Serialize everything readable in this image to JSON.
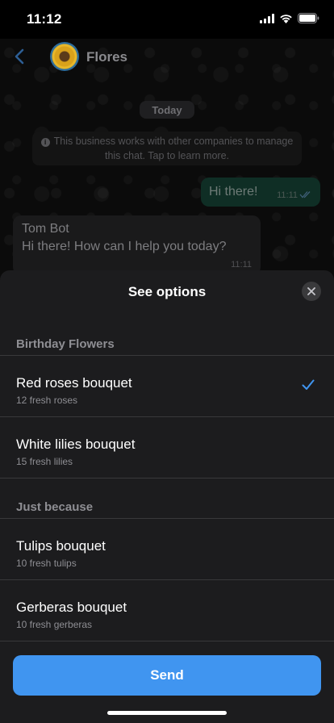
{
  "status_bar": {
    "time": "11:12"
  },
  "chat": {
    "title": "Flores",
    "date_label": "Today",
    "business_notice": "This business works with other companies to manage this chat. Tap to learn more.",
    "outgoing_message": {
      "text": "Hi there!",
      "time": "11:11"
    },
    "incoming_message": {
      "sender": "Tom Bot",
      "text": "Hi there! How can I help you today?",
      "time": "11:11"
    }
  },
  "sheet": {
    "title": "See options",
    "sections": [
      {
        "header": "Birthday Flowers",
        "options": [
          {
            "title": "Red roses bouquet",
            "subtitle": "12 fresh roses",
            "selected": true
          },
          {
            "title": "White lilies bouquet",
            "subtitle": "15 fresh lilies",
            "selected": false
          }
        ]
      },
      {
        "header": "Just because",
        "options": [
          {
            "title": "Tulips bouquet",
            "subtitle": "10 fresh tulips",
            "selected": false
          },
          {
            "title": "Gerberas bouquet",
            "subtitle": "10 fresh gerberas",
            "selected": false
          }
        ]
      }
    ],
    "send_label": "Send"
  },
  "colors": {
    "accent": "#4095f0",
    "sheet_background": "#1c1c1e",
    "outgoing_bubble": "#0f2e25"
  },
  "icons": [
    "signal-icon",
    "wifi-icon",
    "battery-icon",
    "back-chevron-icon",
    "info-icon",
    "double-check-icon",
    "close-icon",
    "checkmark-icon"
  ]
}
